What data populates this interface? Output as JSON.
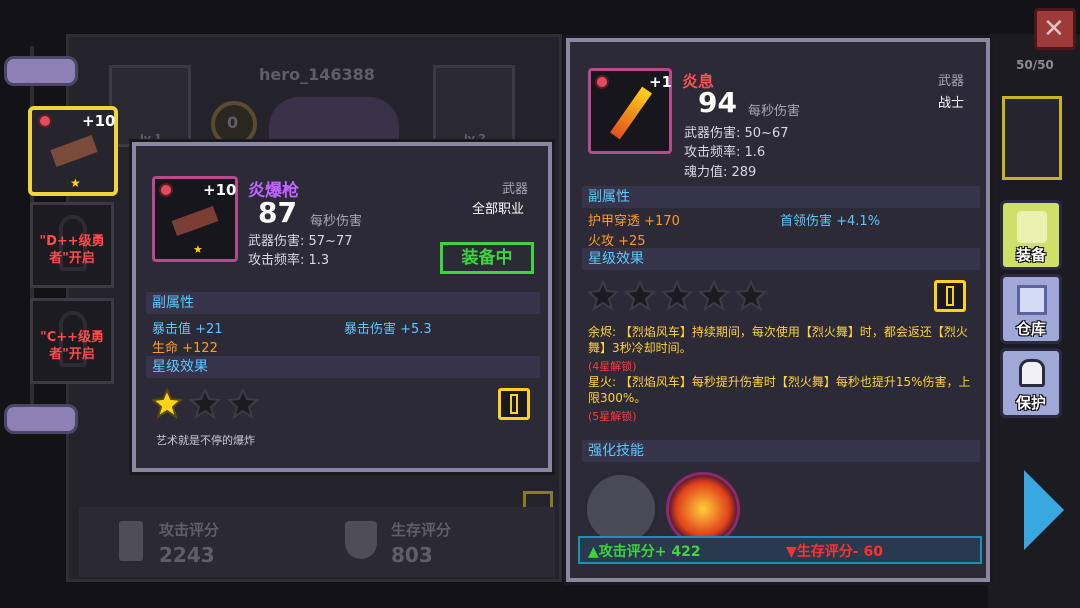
{
  "hero": {
    "name": "hero_146388",
    "slot_level": "0",
    "slot_left_label": "lv.1",
    "slot_right_label": "lv.2"
  },
  "bag_count": "50/50",
  "ratings": {
    "attack_label": "攻击评分",
    "attack_value": "2243",
    "survive_label": "生存评分",
    "survive_value": "803"
  },
  "hero_tabs": [
    {
      "plus": "+10"
    },
    {
      "lock_text": "\"D++级勇者\"开启"
    },
    {
      "lock_text": "\"C++级勇者\"开启"
    }
  ],
  "equipped_item": {
    "name": "炎爆枪",
    "plus": "+10",
    "dps": "87",
    "dps_label": "每秒伤害",
    "type": "武器",
    "class": "全部职业",
    "damage": "武器伤害: 57~77",
    "rate": "攻击频率: 1.3",
    "equipped_label": "装备中",
    "sub_attr_header": "副属性",
    "sub_attrs": [
      "暴击值 +21",
      "暴击伤害 +5.3",
      "生命 +122"
    ],
    "star_header": "星级效果",
    "stars_filled": 1,
    "stars_total": 3,
    "flavor": "艺术就是不停的爆炸"
  },
  "compare_item": {
    "name": "炎息",
    "plus": "+1",
    "dps": "94",
    "dps_label": "每秒伤害",
    "type": "武器",
    "class": "战士",
    "damage": "武器伤害: 50~67",
    "rate": "攻击频率: 1.6",
    "soul": "魂力值: 289",
    "sub_attr_header": "副属性",
    "sub_attrs": [
      "护甲穿透 +170",
      "首领伤害 +4.1%",
      "火攻 +25"
    ],
    "star_header": "星级效果",
    "stars_filled": 0,
    "stars_total": 5,
    "effect1": "余烬: 【烈焰风车】持续期间，每次使用【烈火舞】时，都会返还【烈火舞】3秒冷却时间。",
    "effect1_lock": "(4星解锁)",
    "effect2": "星火: 【烈焰风车】每秒提升伤害时【烈火舞】每秒也提升15%伤害，上限300%。",
    "effect2_lock": "(5星解锁)",
    "skill_header": "强化技能",
    "attack_change": "▲攻击评分+ 422",
    "survive_change": "▼生存评分- 60"
  },
  "side_buttons": [
    "装备",
    "仓库",
    "保护"
  ],
  "colors": {
    "accent_green": "#3dd43d",
    "accent_red": "#ff3030",
    "accent_yellow": "#ffd21a"
  }
}
